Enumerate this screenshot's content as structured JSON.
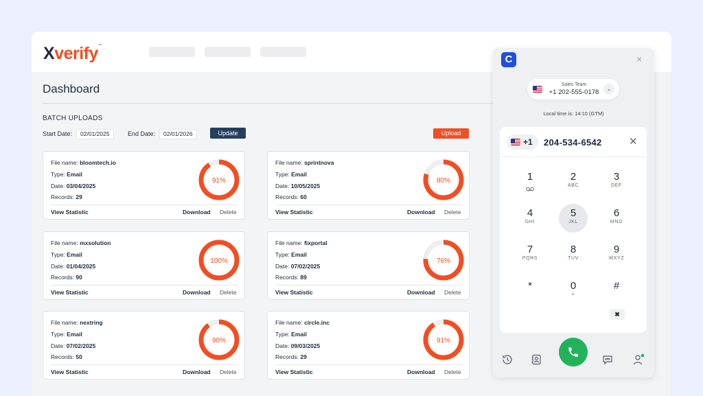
{
  "app": {
    "logo_x": "X",
    "logo_rest": "verify",
    "logo_tm": "™",
    "page_title": "Dashboard",
    "section_title": "BATCH UPLOADS"
  },
  "filters": {
    "start_label": "Start Date:",
    "start_value": "02/01/2025",
    "end_label": "End Date:",
    "end_value": "02/01/2026",
    "update_label": "Update",
    "upload_label": "Upload"
  },
  "labels": {
    "file_name": "File name:",
    "type": "Type:",
    "date": "Date:",
    "records": "Records:",
    "view_statistic": "View Statistic",
    "download": "Download",
    "delete": "Delete"
  },
  "cards": [
    {
      "file_name": "bloomtech.io",
      "type": "Email",
      "date": "03/04/2025",
      "records": "29",
      "percent": 91,
      "percent_label": "91%"
    },
    {
      "file_name": "sprintnova",
      "type": "Email",
      "date": "10/05/2025",
      "records": "60",
      "percent": 80,
      "percent_label": "80%"
    },
    {
      "file_name": "mxsolution",
      "type": "Email",
      "date": "01/04/2025",
      "records": "90",
      "percent": 100,
      "percent_label": "100%"
    },
    {
      "file_name": "fixportal",
      "type": "Email",
      "date": "07/02/2025",
      "records": "89",
      "percent": 76,
      "percent_label": "76%"
    },
    {
      "file_name": "nextring",
      "type": "Email",
      "date": "07/02/2025",
      "records": "50",
      "percent": 90,
      "percent_label": "90%"
    },
    {
      "file_name": "circle.inc",
      "type": "Email",
      "date": "09/03/2025",
      "records": "29",
      "percent": 91,
      "percent_label": "91%"
    }
  ],
  "colors": {
    "accent": "#f04e23",
    "ring_track": "#eeeeee",
    "update_button": "#25405c",
    "call_green": "#22b35a",
    "dialer_logo": "#1f4fe0"
  },
  "dialer": {
    "logo_letter": "C",
    "close_icon": "×",
    "account_team": "Sales Team",
    "account_number": "+1 202-555-0178",
    "chevron": "⌄",
    "local_time": "Local time is: 14:10 (GTM)",
    "country_code": "+1",
    "dialed_number": "204-534-6542",
    "clear_icon": "✕",
    "backspace_icon": "✖",
    "keys": [
      {
        "key": "1",
        "sub": "voicemail-icon"
      },
      {
        "key": "2",
        "sub": "ABC"
      },
      {
        "key": "3",
        "sub": "DEF"
      },
      {
        "key": "4",
        "sub": "GHI"
      },
      {
        "key": "5",
        "sub": "JKL"
      },
      {
        "key": "6",
        "sub": "MNO"
      },
      {
        "key": "7",
        "sub": "PQRS"
      },
      {
        "key": "8",
        "sub": "TUV"
      },
      {
        "key": "9",
        "sub": "WXYZ"
      },
      {
        "key": "*",
        "sub": ""
      },
      {
        "key": "0",
        "sub": "+"
      },
      {
        "key": "#",
        "sub": ""
      }
    ],
    "footer_icons": [
      "history-icon",
      "contacts-icon",
      "call-icon",
      "chat-icon",
      "profile-icon"
    ],
    "status_online_color": "#22b35a"
  }
}
